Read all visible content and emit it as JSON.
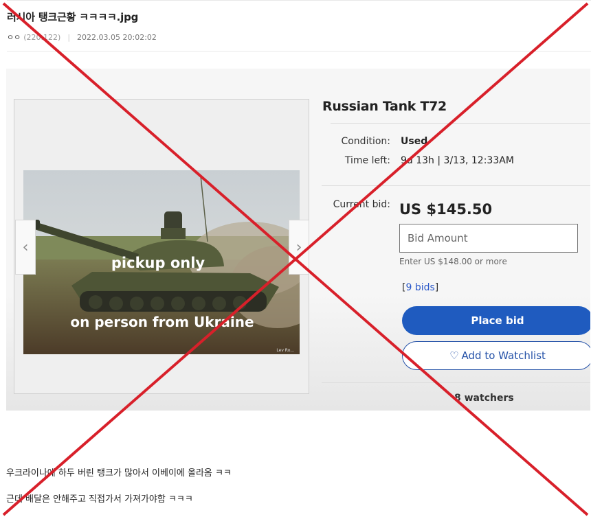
{
  "post": {
    "title": "러시아 탱크근황 ㅋㅋㅋㅋ.jpg",
    "nickname": "ㅇㅇ",
    "ip": "(220.122)",
    "separator": "|",
    "date": "2022.03.05 20:02:02"
  },
  "listing": {
    "title": "Russian Tank T72",
    "condition_label": "Condition:",
    "condition_value": "Used",
    "time_left_label": "Time left:",
    "time_left_value": "9d 13h",
    "time_left_end": "| 3/13, 12:33AM",
    "current_bid_label": "Current bid:",
    "price": "US $145.50",
    "bid_placeholder": "Bid Amount",
    "hint": "Enter US $148.00 or more",
    "bids_open": "[",
    "bids_link": "9 bids",
    "bids_close": "]",
    "place_bid": "Place bid",
    "watchlist": "Add to Watchlist",
    "watchers": "8 watchers",
    "photo_caption_1": "pickup only",
    "photo_caption_2": "on person from Ukraine",
    "photo_watermark": "Lev Ro..."
  },
  "body": {
    "line1": "우크라이나에 하두 버린 탱크가 많아서 이베이에 올라옴 ㅋㅋ",
    "line2": "근데 배달은 안해주고 직접가서 가져가야함 ㅋㅋㅋ"
  },
  "icons": {
    "left_arrow": "chevron-left-icon",
    "right_arrow": "chevron-right-icon",
    "heart": "heart-icon"
  },
  "colors": {
    "accent_blue": "#1f5bbf",
    "link_blue": "#2a58c9",
    "cross_red": "#d8202a"
  }
}
